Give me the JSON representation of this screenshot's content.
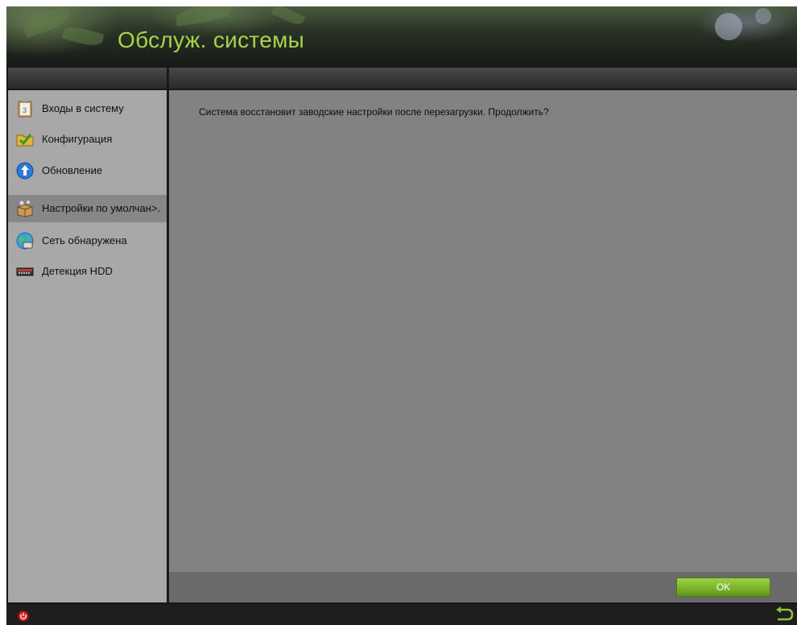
{
  "header": {
    "title": "Обслуж. системы"
  },
  "sidebar": {
    "items": [
      {
        "label": "Входы в систему",
        "icon": "log-notepad-icon",
        "active": false
      },
      {
        "label": "Конфигурация",
        "icon": "folder-check-icon",
        "active": false
      },
      {
        "label": "Обновление",
        "icon": "upgrade-arrow-icon",
        "active": false
      },
      {
        "label": "Настройки по умолчан>.",
        "icon": "default-box-icon",
        "active": true
      },
      {
        "label": "Сеть обнаружена",
        "icon": "network-globe-icon",
        "active": false
      },
      {
        "label": "Детекция HDD",
        "icon": "hdd-icon",
        "active": false
      }
    ]
  },
  "main": {
    "message": "Система восстановит заводские настройки после перезагрузки. Продолжить?"
  },
  "footer": {
    "ok_label": "OK"
  },
  "statusbar": {
    "power_icon": "power-icon",
    "back_icon": "back-arrow-icon"
  },
  "colors": {
    "title": "#a6d44a",
    "ok_button": "#7bb52c",
    "sidebar_bg": "#a8a8a8",
    "main_bg": "#828282"
  }
}
